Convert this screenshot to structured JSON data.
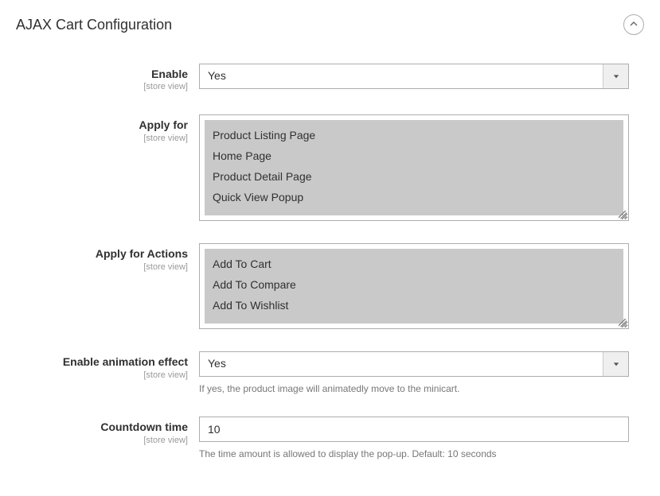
{
  "section": {
    "title": "AJAX Cart Configuration"
  },
  "fields": {
    "enable": {
      "label": "Enable",
      "scope": "[store view]",
      "value": "Yes"
    },
    "apply_for": {
      "label": "Apply for",
      "scope": "[store view]",
      "options": [
        "Product Listing Page",
        "Home Page",
        "Product Detail Page",
        "Quick View Popup"
      ]
    },
    "apply_for_actions": {
      "label": "Apply for Actions",
      "scope": "[store view]",
      "options": [
        "Add To Cart",
        "Add To Compare",
        "Add To Wishlist"
      ]
    },
    "enable_animation": {
      "label": "Enable animation effect",
      "scope": "[store view]",
      "value": "Yes",
      "helper": "If yes, the product image will animatedly move to the minicart."
    },
    "countdown": {
      "label": "Countdown time",
      "scope": "[store view]",
      "value": "10",
      "helper": "The time amount is allowed to display the pop-up. Default: 10 seconds"
    }
  }
}
